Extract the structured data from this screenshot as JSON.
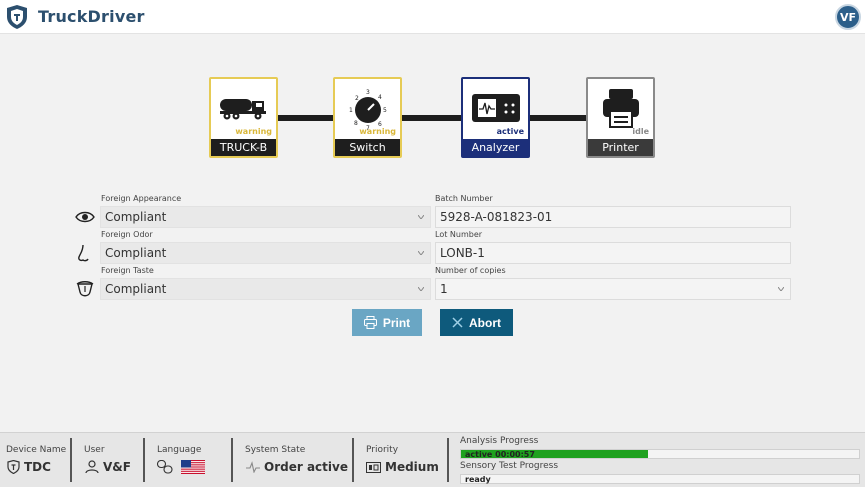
{
  "header": {
    "app_title": "TruckDriver",
    "avatar_initials": "VF"
  },
  "workflow": {
    "nodes": [
      {
        "label": "TRUCK-B",
        "state": "warning",
        "icon": "truck-icon"
      },
      {
        "label": "Switch",
        "state": "warning",
        "icon": "switch-dial-icon",
        "dial_numbers": [
          "1",
          "2",
          "3",
          "4",
          "5",
          "6",
          "7",
          "8"
        ]
      },
      {
        "label": "Analyzer",
        "state": "active",
        "icon": "analyzer-icon"
      },
      {
        "label": "Printer",
        "state": "idle",
        "icon": "printer-icon"
      }
    ],
    "colors": {
      "warning": "#e6cb55",
      "active": "#1c2f7a",
      "idle": "#8a8a8a"
    }
  },
  "form": {
    "foreign_appearance": {
      "label": "Foreign Appearance",
      "value": "Compliant",
      "icon": "eye-icon"
    },
    "foreign_odor": {
      "label": "Foreign Odor",
      "value": "Compliant",
      "icon": "nose-icon"
    },
    "foreign_taste": {
      "label": "Foreign Taste",
      "value": "Compliant",
      "icon": "tongue-icon"
    },
    "batch_number": {
      "label": "Batch Number",
      "value": "5928-A-081823-01"
    },
    "lot_number": {
      "label": "Lot Number",
      "value": "LONB-1"
    },
    "number_of_copies": {
      "label": "Number of copies",
      "value": "1"
    }
  },
  "buttons": {
    "print": "Print",
    "abort": "Abort",
    "print_color": "#6aa6c4",
    "abort_color": "#0e5a7c"
  },
  "statusbar": {
    "device_name": {
      "title": "Device Name",
      "value": "TDC"
    },
    "user": {
      "title": "User",
      "value": "V&F"
    },
    "language": {
      "title": "Language",
      "value_icon": "us-flag-icon"
    },
    "system_state": {
      "title": "System State",
      "value": "Order active"
    },
    "priority": {
      "title": "Priority",
      "value": "Medium"
    },
    "analysis_progress": {
      "title": "Analysis Progress",
      "text": "active 00:00:57",
      "percent": 47
    },
    "sensory_progress": {
      "title": "Sensory Test Progress",
      "text": "ready",
      "percent": 0
    }
  }
}
